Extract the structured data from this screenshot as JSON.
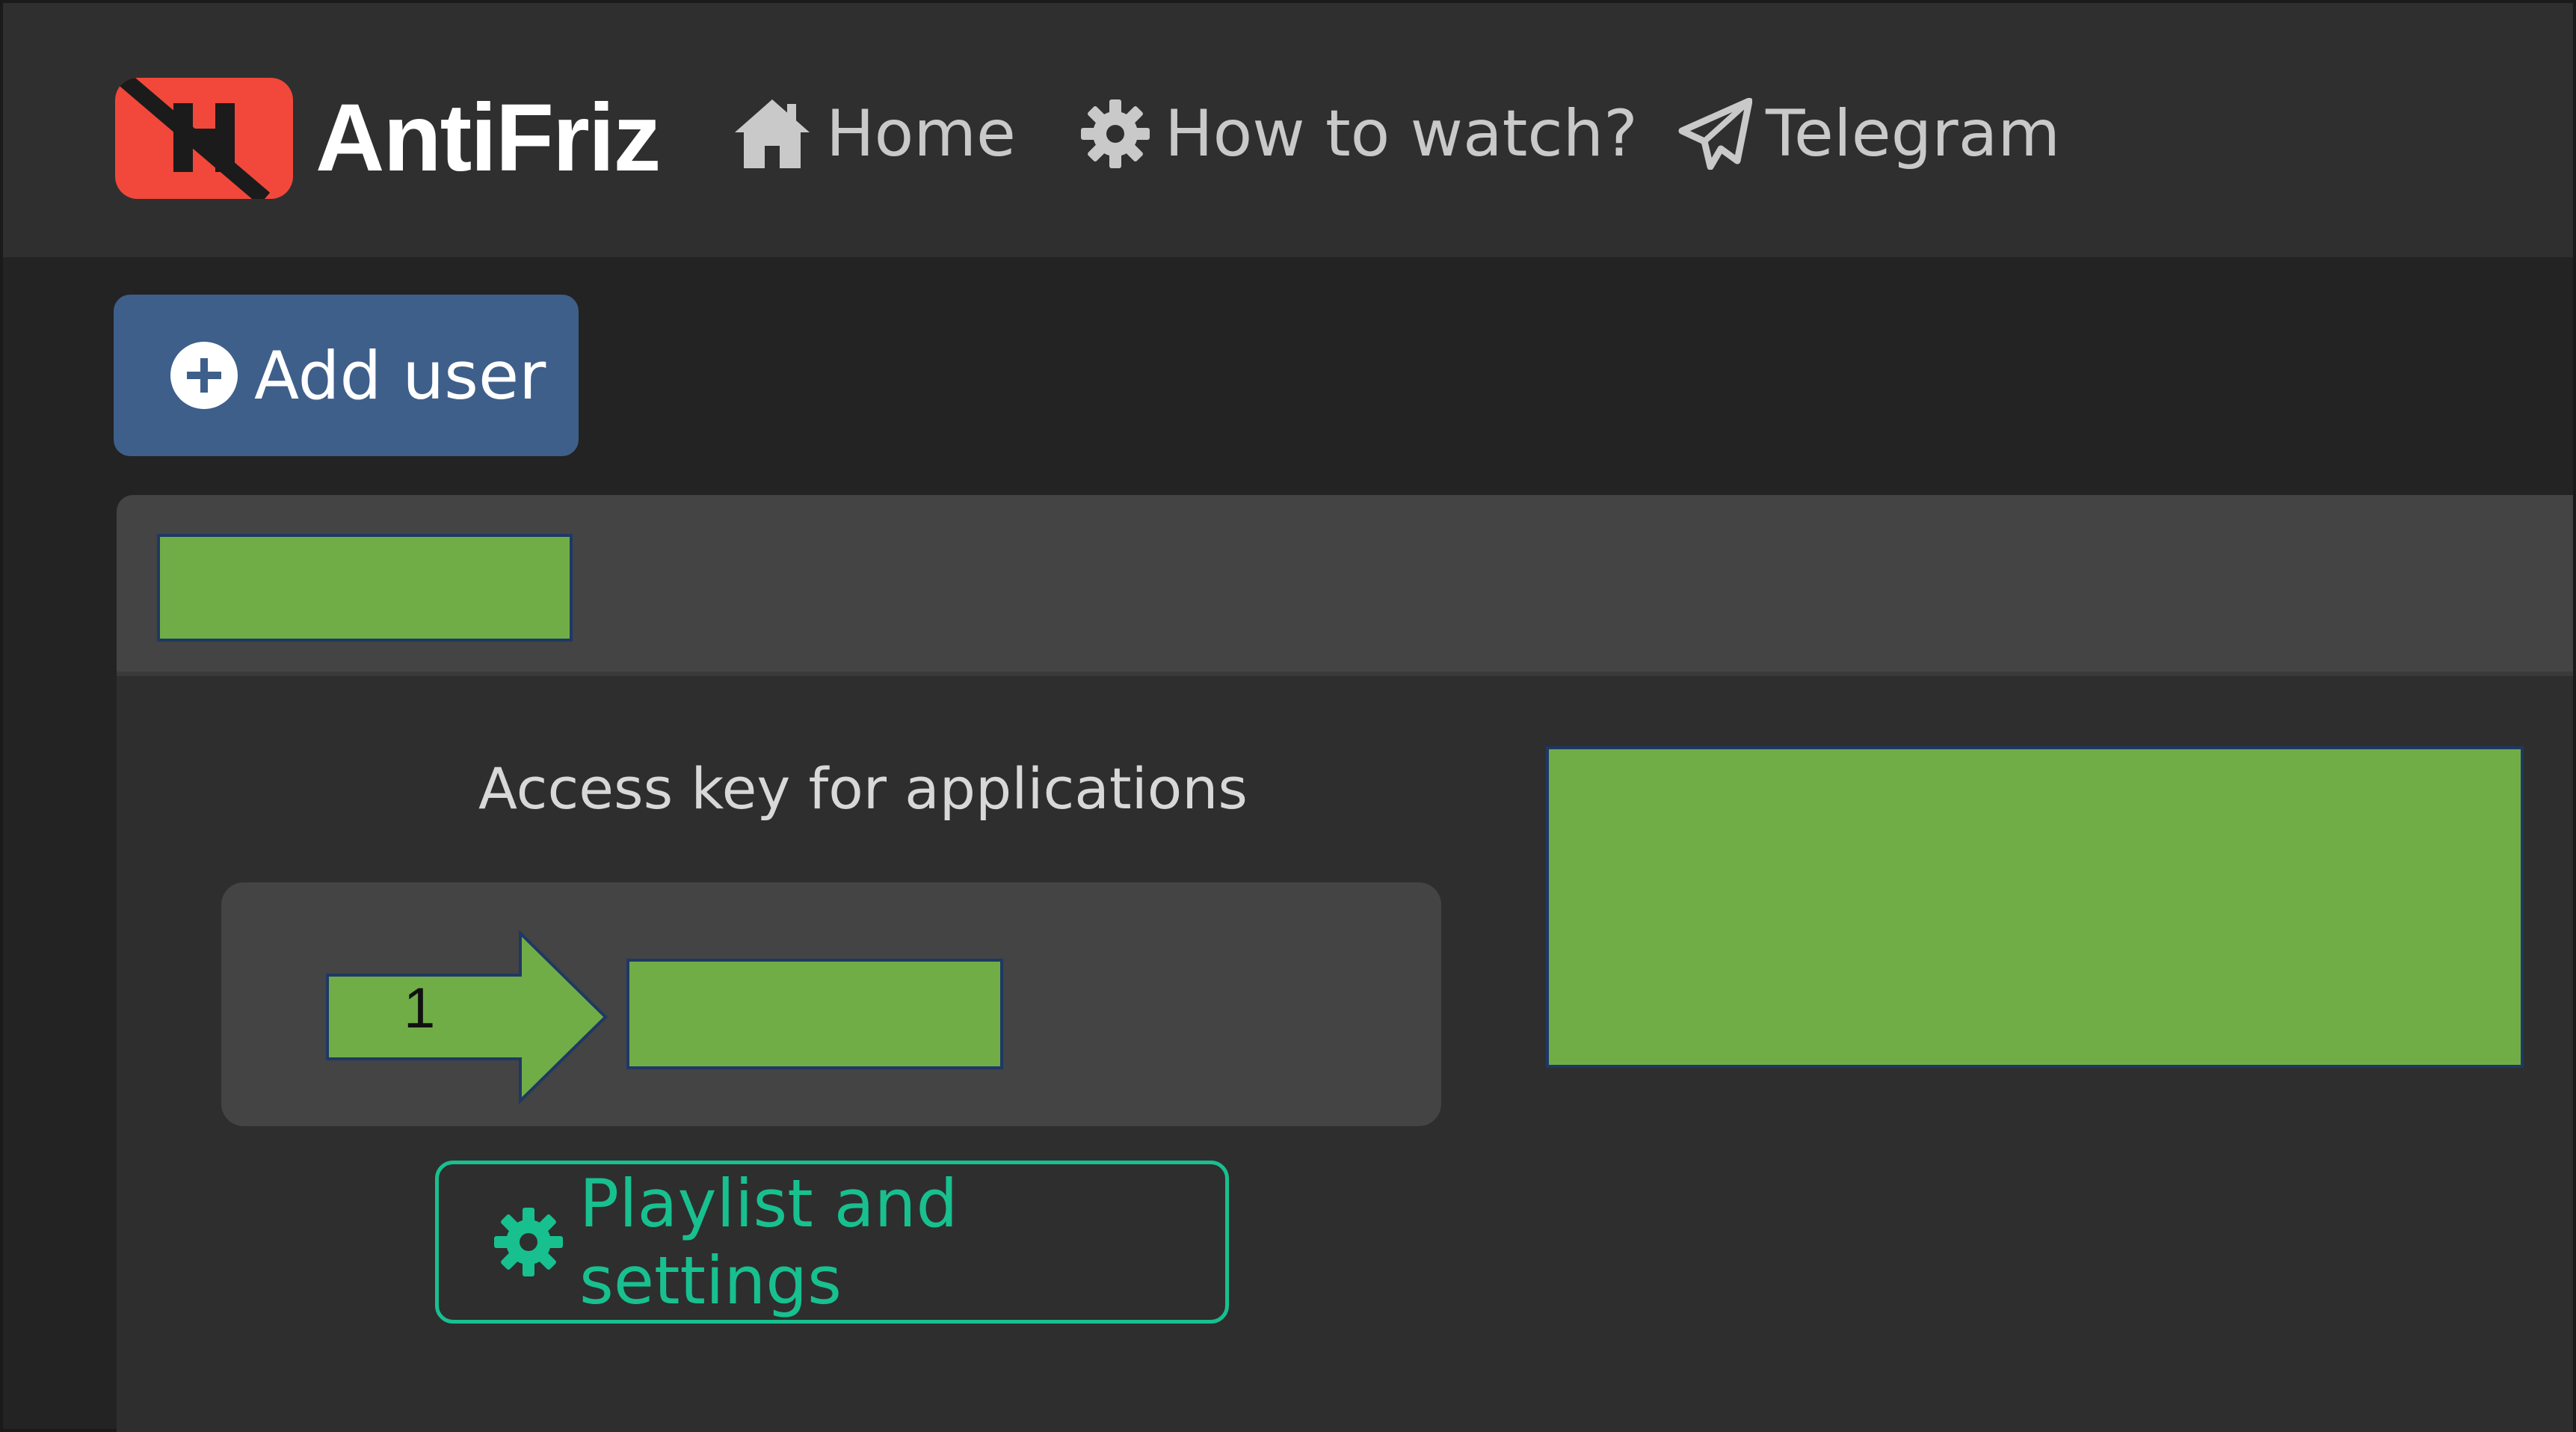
{
  "brand": {
    "name": "AntiFriz",
    "logo_color": "#f2483b"
  },
  "nav": {
    "items": [
      {
        "label": "Home",
        "icon": "home-icon"
      },
      {
        "label": "How to watch?",
        "icon": "gear-icon"
      },
      {
        "label": "Telegram",
        "icon": "paper-plane-icon"
      }
    ]
  },
  "toolbar": {
    "add_user_label": "Add user",
    "add_user_icon": "plus-circle-icon"
  },
  "user_card": {
    "access_key_label": "Access key for applications",
    "callout_number": "1",
    "playlist_button_label": "Playlist and settings",
    "playlist_icon": "gear-icon"
  },
  "colors": {
    "accent_primary": "#3e5f8a",
    "accent_success": "#18c08f",
    "redaction": "#70ad47"
  }
}
